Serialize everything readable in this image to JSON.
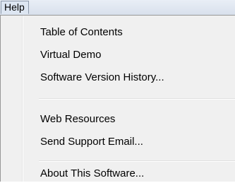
{
  "menubar": {
    "help_label": "Help"
  },
  "help_menu": {
    "items": [
      {
        "label": "Table of Contents"
      },
      {
        "label": "Virtual Demo"
      },
      {
        "label": "Software Version History..."
      },
      {
        "label": "Web Resources"
      },
      {
        "label": "Send Support Email..."
      },
      {
        "label": "About This Software..."
      }
    ]
  }
}
